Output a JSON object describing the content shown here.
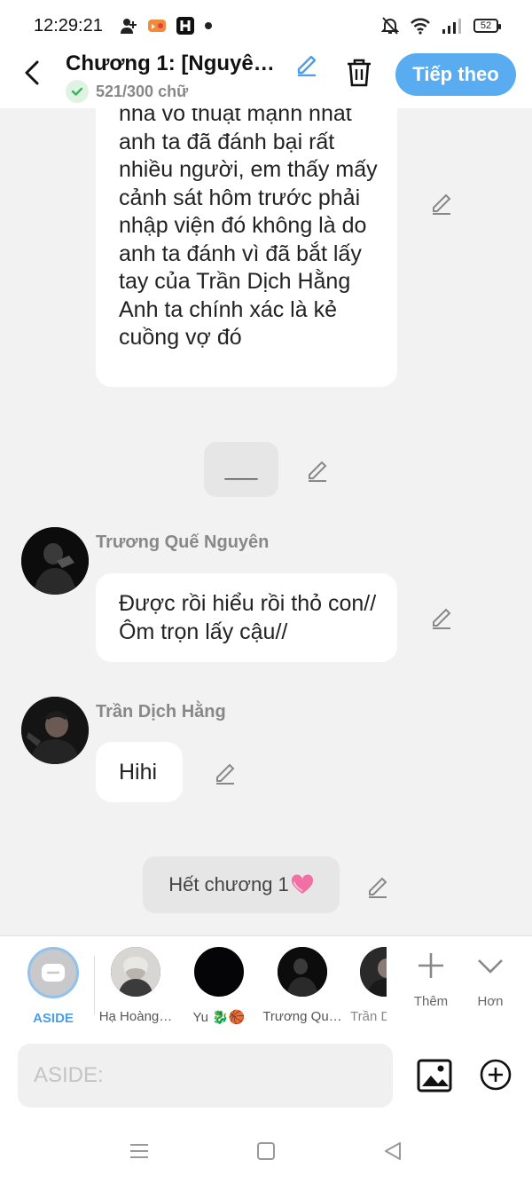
{
  "status_bar": {
    "time": "12:29:21",
    "left_icons": [
      "person-add-icon",
      "game-app-icon",
      "h-app-icon",
      "dot-icon"
    ],
    "right_icons": [
      "bell-off-icon",
      "wifi-icon",
      "signal-icon"
    ],
    "battery": "52"
  },
  "header": {
    "title": "Chương 1: [Nguyên…",
    "word_count": "521/300 chữ",
    "next_label": "Tiếp theo",
    "accent_color": "#5aacf1"
  },
  "messages": [
    {
      "kind": "text",
      "text": "nha võ thuật mạnh nhất anh ta đã đánh bại rất nhiều người, em thấy mấy cảnh sát hôm trước phải nhập viện đó không là do anh ta đánh vì đã bắt lấy tay của Trần Dịch Hằng Anh ta chính xác là kẻ cuồng vợ đó"
    },
    {
      "kind": "aside",
      "text": "___"
    },
    {
      "kind": "text",
      "sender": "Trương Quế Nguyên",
      "text": "Được rồi hiểu rồi thỏ con// Ôm trọn lấy cậu//"
    },
    {
      "kind": "text",
      "sender": "Trần Dịch Hằng",
      "text": "Hihi"
    },
    {
      "kind": "aside",
      "text": "Hết chương 1"
    }
  ],
  "characters": [
    {
      "name": "ASIDE"
    },
    {
      "name": "Hạ Hoàng…"
    },
    {
      "name": "Yu 🐉🏀"
    },
    {
      "name": "Trương Qu…"
    },
    {
      "name": "Trần D"
    }
  ],
  "tools": {
    "add_label": "Thêm",
    "more_label": "Hơn"
  },
  "input": {
    "placeholder": "ASIDE:",
    "value": ""
  }
}
